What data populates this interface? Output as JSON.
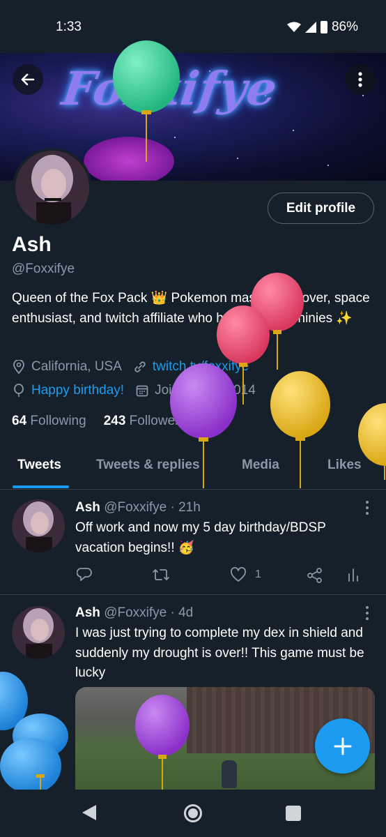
{
  "status": {
    "time": "1:33",
    "battery": "86%"
  },
  "banner": {
    "title": "Foxxifye"
  },
  "profile": {
    "edit_label": "Edit profile",
    "name": "Ash",
    "handle": "@Foxxifye",
    "bio": "Queen of the Fox Pack 👑 Pokemon master, fox lover, space enthusiast, and twitch affiliate who hunts all the shinies ✨",
    "location": "California, USA",
    "website": "twitch.tv/foxxifye",
    "birthday": "Happy birthday!",
    "joined": "Joined May 2014",
    "following_count": "64",
    "following_label": "Following",
    "followers_count": "243",
    "followers_label": "Followers"
  },
  "tabs": [
    "Tweets",
    "Tweets & replies",
    "Media",
    "Likes"
  ],
  "tweets": [
    {
      "name": "Ash",
      "handle": "@Foxxifye",
      "time": "· 21h",
      "text": "Off work and now my 5 day birthday/BDSP vacation begins!! 🥳",
      "likes": "1"
    },
    {
      "name": "Ash",
      "handle": "@Foxxifye",
      "time": "· 4d",
      "text": "I was just trying to complete my dex in shield and suddenly my drought is over!! This game must be  lucky"
    }
  ],
  "icons": {
    "back": "arrow-left-icon",
    "more": "more-vertical-icon",
    "location": "location-pin-icon",
    "link": "link-icon",
    "birthday": "balloon-icon",
    "calendar": "calendar-icon",
    "reply": "reply-icon",
    "retweet": "retweet-icon",
    "like": "heart-icon",
    "share": "share-icon",
    "analytics": "analytics-icon",
    "compose": "plus-icon"
  },
  "colors": {
    "background": "#15202b",
    "accent": "#1d9bf0",
    "secondary_text": "#8b98a5",
    "border": "#38444d"
  }
}
